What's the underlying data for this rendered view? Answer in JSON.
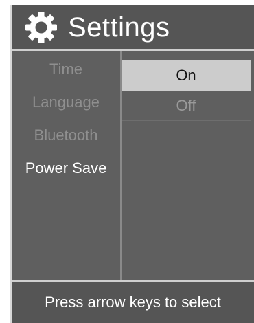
{
  "header": {
    "title": "Settings",
    "icon": "gear-icon"
  },
  "menu": {
    "items": [
      {
        "label": "Time",
        "active": false
      },
      {
        "label": "Language",
        "active": false
      },
      {
        "label": "Bluetooth",
        "active": false
      },
      {
        "label": "Power Save",
        "active": true
      }
    ]
  },
  "options": {
    "items": [
      {
        "label": "On",
        "selected": true
      },
      {
        "label": "Off",
        "selected": false
      }
    ]
  },
  "footer": {
    "hint": "Press arrow keys to select"
  },
  "colors": {
    "background": "#5f5f5f",
    "bar": "#555555",
    "selected_bg": "#cccccc",
    "inactive_text": "#8f8f8f",
    "active_text": "#ffffff"
  }
}
